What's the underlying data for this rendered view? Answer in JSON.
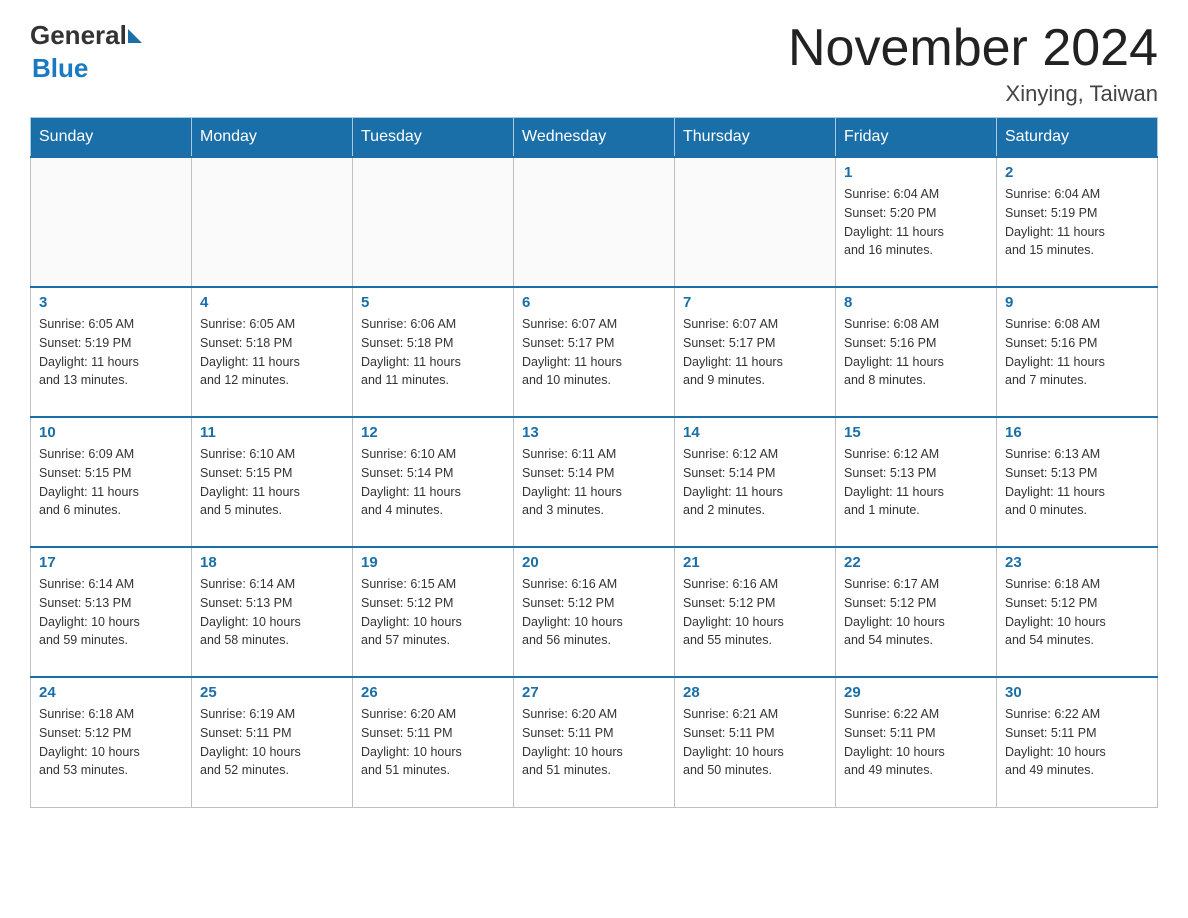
{
  "header": {
    "logo_general": "General",
    "logo_blue": "Blue",
    "month_title": "November 2024",
    "location": "Xinying, Taiwan"
  },
  "days_of_week": [
    "Sunday",
    "Monday",
    "Tuesday",
    "Wednesday",
    "Thursday",
    "Friday",
    "Saturday"
  ],
  "weeks": [
    {
      "days": [
        {
          "num": "",
          "info": ""
        },
        {
          "num": "",
          "info": ""
        },
        {
          "num": "",
          "info": ""
        },
        {
          "num": "",
          "info": ""
        },
        {
          "num": "",
          "info": ""
        },
        {
          "num": "1",
          "info": "Sunrise: 6:04 AM\nSunset: 5:20 PM\nDaylight: 11 hours\nand 16 minutes."
        },
        {
          "num": "2",
          "info": "Sunrise: 6:04 AM\nSunset: 5:19 PM\nDaylight: 11 hours\nand 15 minutes."
        }
      ]
    },
    {
      "days": [
        {
          "num": "3",
          "info": "Sunrise: 6:05 AM\nSunset: 5:19 PM\nDaylight: 11 hours\nand 13 minutes."
        },
        {
          "num": "4",
          "info": "Sunrise: 6:05 AM\nSunset: 5:18 PM\nDaylight: 11 hours\nand 12 minutes."
        },
        {
          "num": "5",
          "info": "Sunrise: 6:06 AM\nSunset: 5:18 PM\nDaylight: 11 hours\nand 11 minutes."
        },
        {
          "num": "6",
          "info": "Sunrise: 6:07 AM\nSunset: 5:17 PM\nDaylight: 11 hours\nand 10 minutes."
        },
        {
          "num": "7",
          "info": "Sunrise: 6:07 AM\nSunset: 5:17 PM\nDaylight: 11 hours\nand 9 minutes."
        },
        {
          "num": "8",
          "info": "Sunrise: 6:08 AM\nSunset: 5:16 PM\nDaylight: 11 hours\nand 8 minutes."
        },
        {
          "num": "9",
          "info": "Sunrise: 6:08 AM\nSunset: 5:16 PM\nDaylight: 11 hours\nand 7 minutes."
        }
      ]
    },
    {
      "days": [
        {
          "num": "10",
          "info": "Sunrise: 6:09 AM\nSunset: 5:15 PM\nDaylight: 11 hours\nand 6 minutes."
        },
        {
          "num": "11",
          "info": "Sunrise: 6:10 AM\nSunset: 5:15 PM\nDaylight: 11 hours\nand 5 minutes."
        },
        {
          "num": "12",
          "info": "Sunrise: 6:10 AM\nSunset: 5:14 PM\nDaylight: 11 hours\nand 4 minutes."
        },
        {
          "num": "13",
          "info": "Sunrise: 6:11 AM\nSunset: 5:14 PM\nDaylight: 11 hours\nand 3 minutes."
        },
        {
          "num": "14",
          "info": "Sunrise: 6:12 AM\nSunset: 5:14 PM\nDaylight: 11 hours\nand 2 minutes."
        },
        {
          "num": "15",
          "info": "Sunrise: 6:12 AM\nSunset: 5:13 PM\nDaylight: 11 hours\nand 1 minute."
        },
        {
          "num": "16",
          "info": "Sunrise: 6:13 AM\nSunset: 5:13 PM\nDaylight: 11 hours\nand 0 minutes."
        }
      ]
    },
    {
      "days": [
        {
          "num": "17",
          "info": "Sunrise: 6:14 AM\nSunset: 5:13 PM\nDaylight: 10 hours\nand 59 minutes."
        },
        {
          "num": "18",
          "info": "Sunrise: 6:14 AM\nSunset: 5:13 PM\nDaylight: 10 hours\nand 58 minutes."
        },
        {
          "num": "19",
          "info": "Sunrise: 6:15 AM\nSunset: 5:12 PM\nDaylight: 10 hours\nand 57 minutes."
        },
        {
          "num": "20",
          "info": "Sunrise: 6:16 AM\nSunset: 5:12 PM\nDaylight: 10 hours\nand 56 minutes."
        },
        {
          "num": "21",
          "info": "Sunrise: 6:16 AM\nSunset: 5:12 PM\nDaylight: 10 hours\nand 55 minutes."
        },
        {
          "num": "22",
          "info": "Sunrise: 6:17 AM\nSunset: 5:12 PM\nDaylight: 10 hours\nand 54 minutes."
        },
        {
          "num": "23",
          "info": "Sunrise: 6:18 AM\nSunset: 5:12 PM\nDaylight: 10 hours\nand 54 minutes."
        }
      ]
    },
    {
      "days": [
        {
          "num": "24",
          "info": "Sunrise: 6:18 AM\nSunset: 5:12 PM\nDaylight: 10 hours\nand 53 minutes."
        },
        {
          "num": "25",
          "info": "Sunrise: 6:19 AM\nSunset: 5:11 PM\nDaylight: 10 hours\nand 52 minutes."
        },
        {
          "num": "26",
          "info": "Sunrise: 6:20 AM\nSunset: 5:11 PM\nDaylight: 10 hours\nand 51 minutes."
        },
        {
          "num": "27",
          "info": "Sunrise: 6:20 AM\nSunset: 5:11 PM\nDaylight: 10 hours\nand 51 minutes."
        },
        {
          "num": "28",
          "info": "Sunrise: 6:21 AM\nSunset: 5:11 PM\nDaylight: 10 hours\nand 50 minutes."
        },
        {
          "num": "29",
          "info": "Sunrise: 6:22 AM\nSunset: 5:11 PM\nDaylight: 10 hours\nand 49 minutes."
        },
        {
          "num": "30",
          "info": "Sunrise: 6:22 AM\nSunset: 5:11 PM\nDaylight: 10 hours\nand 49 minutes."
        }
      ]
    }
  ]
}
